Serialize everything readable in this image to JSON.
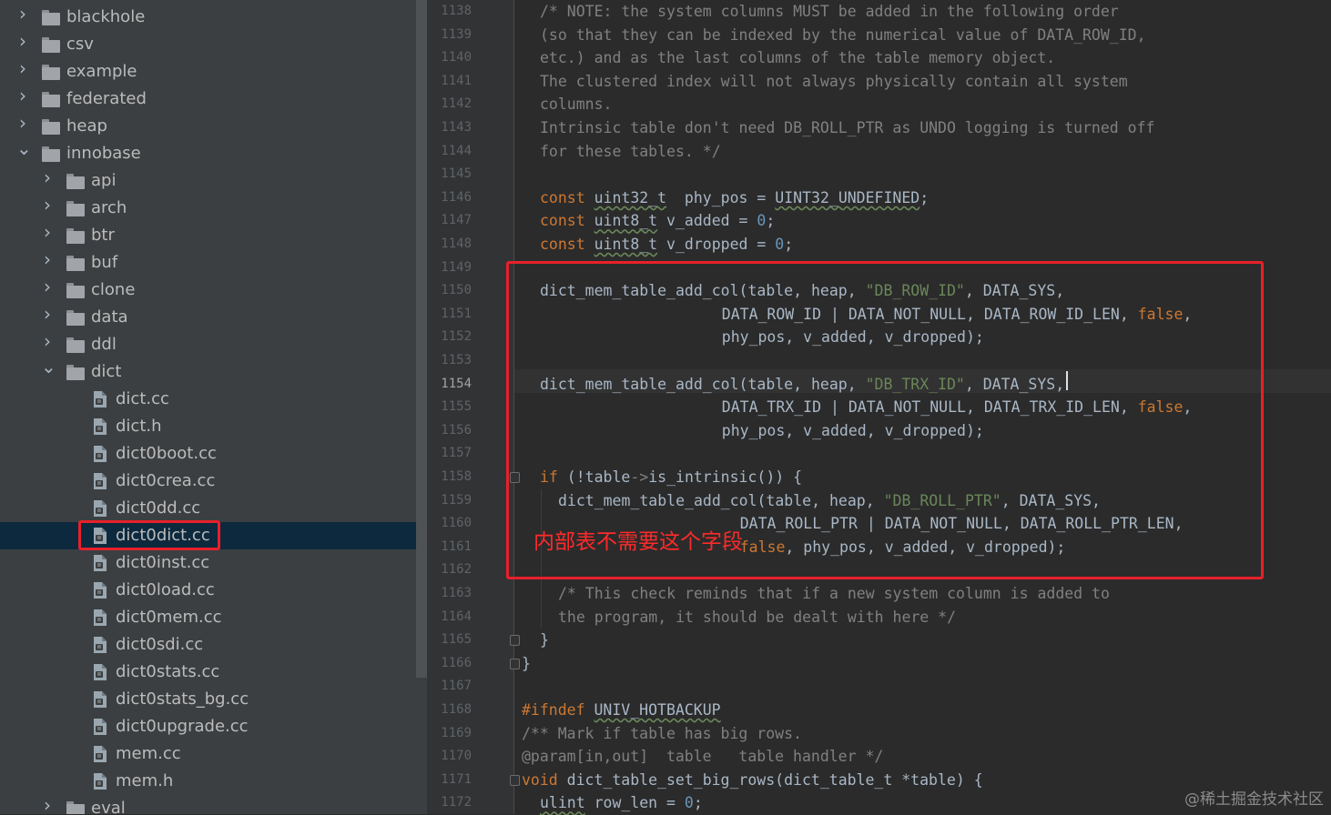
{
  "project_tree": {
    "items": [
      {
        "label": "blackhole",
        "type": "folder",
        "depth": 0,
        "expanded": false
      },
      {
        "label": "csv",
        "type": "folder",
        "depth": 0,
        "expanded": false
      },
      {
        "label": "example",
        "type": "folder",
        "depth": 0,
        "expanded": false
      },
      {
        "label": "federated",
        "type": "folder",
        "depth": 0,
        "expanded": false
      },
      {
        "label": "heap",
        "type": "folder",
        "depth": 0,
        "expanded": false
      },
      {
        "label": "innobase",
        "type": "folder",
        "depth": 0,
        "expanded": true
      },
      {
        "label": "api",
        "type": "folder",
        "depth": 1,
        "expanded": false
      },
      {
        "label": "arch",
        "type": "folder",
        "depth": 1,
        "expanded": false
      },
      {
        "label": "btr",
        "type": "folder",
        "depth": 1,
        "expanded": false
      },
      {
        "label": "buf",
        "type": "folder",
        "depth": 1,
        "expanded": false
      },
      {
        "label": "clone",
        "type": "folder",
        "depth": 1,
        "expanded": false
      },
      {
        "label": "data",
        "type": "folder",
        "depth": 1,
        "expanded": false
      },
      {
        "label": "ddl",
        "type": "folder",
        "depth": 1,
        "expanded": false
      },
      {
        "label": "dict",
        "type": "folder",
        "depth": 1,
        "expanded": true
      },
      {
        "label": "dict.cc",
        "type": "file",
        "depth": 2
      },
      {
        "label": "dict.h",
        "type": "file",
        "depth": 2
      },
      {
        "label": "dict0boot.cc",
        "type": "file",
        "depth": 2
      },
      {
        "label": "dict0crea.cc",
        "type": "file",
        "depth": 2
      },
      {
        "label": "dict0dd.cc",
        "type": "file",
        "depth": 2
      },
      {
        "label": "dict0dict.cc",
        "type": "file",
        "depth": 2,
        "selected": true
      },
      {
        "label": "dict0inst.cc",
        "type": "file",
        "depth": 2
      },
      {
        "label": "dict0load.cc",
        "type": "file",
        "depth": 2
      },
      {
        "label": "dict0mem.cc",
        "type": "file",
        "depth": 2
      },
      {
        "label": "dict0sdi.cc",
        "type": "file",
        "depth": 2
      },
      {
        "label": "dict0stats.cc",
        "type": "file",
        "depth": 2
      },
      {
        "label": "dict0stats_bg.cc",
        "type": "file",
        "depth": 2
      },
      {
        "label": "dict0upgrade.cc",
        "type": "file",
        "depth": 2
      },
      {
        "label": "mem.cc",
        "type": "file",
        "depth": 2
      },
      {
        "label": "mem.h",
        "type": "file",
        "depth": 2
      },
      {
        "label": "eval",
        "type": "folder",
        "depth": 1,
        "expanded": false
      }
    ]
  },
  "editor": {
    "current_line": "1154",
    "lines": [
      {
        "n": "1138",
        "indent": 1,
        "tokens": [
          [
            "cm",
            "/* NOTE: the system columns MUST be added in the following order"
          ]
        ]
      },
      {
        "n": "1139",
        "indent": 1,
        "tokens": [
          [
            "cm",
            "(so that they can be indexed by the numerical value of DATA_ROW_ID,"
          ]
        ]
      },
      {
        "n": "1140",
        "indent": 1,
        "tokens": [
          [
            "cm",
            "etc.) and as the last columns of the table memory object."
          ]
        ]
      },
      {
        "n": "1141",
        "indent": 1,
        "tokens": [
          [
            "cm",
            "The clustered index will not always physically contain all system"
          ]
        ]
      },
      {
        "n": "1142",
        "indent": 1,
        "tokens": [
          [
            "cm",
            "columns."
          ]
        ]
      },
      {
        "n": "1143",
        "indent": 1,
        "tokens": [
          [
            "cm",
            "Intrinsic table don't need DB_ROLL_PTR as UNDO logging is turned off"
          ]
        ]
      },
      {
        "n": "1144",
        "indent": 1,
        "tokens": [
          [
            "cm",
            "for these tables. */"
          ]
        ]
      },
      {
        "n": "1145",
        "indent": 1,
        "tokens": []
      },
      {
        "n": "1146",
        "indent": 1,
        "tokens": [
          [
            "kw",
            "const "
          ],
          [
            "ul",
            "uint32_t"
          ],
          [
            "",
            "  phy_pos = "
          ],
          [
            "ul",
            "UINT32_UNDEFINED"
          ],
          [
            "",
            ";"
          ]
        ]
      },
      {
        "n": "1147",
        "indent": 1,
        "tokens": [
          [
            "kw",
            "const "
          ],
          [
            "ul",
            "uint8_t"
          ],
          [
            "",
            " v_added = "
          ],
          [
            "num",
            "0"
          ],
          [
            "",
            ";"
          ]
        ]
      },
      {
        "n": "1148",
        "indent": 1,
        "tokens": [
          [
            "kw",
            "const "
          ],
          [
            "ul",
            "uint8_t"
          ],
          [
            "",
            " v_dropped = "
          ],
          [
            "num",
            "0"
          ],
          [
            "",
            ";"
          ]
        ]
      },
      {
        "n": "1149",
        "indent": 1,
        "tokens": []
      },
      {
        "n": "1150",
        "indent": 1,
        "tokens": [
          [
            "",
            "dict_mem_table_add_col(table, heap, "
          ],
          [
            "str",
            "\"DB_ROW_ID\""
          ],
          [
            "",
            ", DATA_SYS,"
          ]
        ]
      },
      {
        "n": "1151",
        "indent": 11,
        "tokens": [
          [
            "",
            "DATA_ROW_ID | DATA_NOT_NULL, DATA_ROW_ID_LEN, "
          ],
          [
            "kw",
            "false"
          ],
          [
            "",
            ","
          ]
        ]
      },
      {
        "n": "1152",
        "indent": 11,
        "tokens": [
          [
            "",
            "phy_pos, v_added, v_dropped);"
          ]
        ]
      },
      {
        "n": "1153",
        "indent": 1,
        "tokens": []
      },
      {
        "n": "1154",
        "indent": 1,
        "tokens": [
          [
            "",
            "dict_mem_table_add_col(table, heap, "
          ],
          [
            "str",
            "\"DB_TRX_ID\""
          ],
          [
            "",
            ", DATA_SYS,"
          ]
        ]
      },
      {
        "n": "1155",
        "indent": 11,
        "tokens": [
          [
            "",
            "DATA_TRX_ID | DATA_NOT_NULL, DATA_TRX_ID_LEN, "
          ],
          [
            "kw",
            "false"
          ],
          [
            "",
            ","
          ]
        ]
      },
      {
        "n": "1156",
        "indent": 11,
        "tokens": [
          [
            "",
            "phy_pos, v_added, v_dropped);"
          ]
        ]
      },
      {
        "n": "1157",
        "indent": 1,
        "tokens": []
      },
      {
        "n": "1158",
        "indent": 1,
        "tokens": [
          [
            "kw",
            "if"
          ],
          [
            "",
            " (!table"
          ],
          [
            "cm",
            "->"
          ],
          [
            "",
            "is_intrinsic()) {"
          ]
        ]
      },
      {
        "n": "1159",
        "indent": 2,
        "tokens": [
          [
            "",
            "dict_mem_table_add_col(table, heap, "
          ],
          [
            "str",
            "\"DB_ROLL_PTR\""
          ],
          [
            "",
            ", DATA_SYS,"
          ]
        ]
      },
      {
        "n": "1160",
        "indent": 12,
        "tokens": [
          [
            "",
            "DATA_ROLL_PTR | DATA_NOT_NULL, DATA_ROLL_PTR_LEN,"
          ]
        ]
      },
      {
        "n": "1161",
        "indent": 12,
        "tokens": [
          [
            "kw",
            "false"
          ],
          [
            "",
            ", phy_pos, v_added, v_dropped);"
          ]
        ]
      },
      {
        "n": "1162",
        "indent": 1,
        "tokens": []
      },
      {
        "n": "1163",
        "indent": 2,
        "tokens": [
          [
            "cm",
            "/* This check reminds that if a new system column is added to"
          ]
        ]
      },
      {
        "n": "1164",
        "indent": 2,
        "tokens": [
          [
            "cm",
            "the program, it should be dealt with here */"
          ]
        ]
      },
      {
        "n": "1165",
        "indent": 1,
        "tokens": [
          [
            "",
            "}"
          ]
        ]
      },
      {
        "n": "1166",
        "indent": 0,
        "tokens": [
          [
            "",
            "}"
          ]
        ]
      },
      {
        "n": "1167",
        "indent": 0,
        "tokens": []
      },
      {
        "n": "1168",
        "indent": 0,
        "tokens": [
          [
            "kw",
            "#ifndef "
          ],
          [
            "ul",
            "UNIV_HOTBACKUP"
          ]
        ]
      },
      {
        "n": "1169",
        "indent": 0,
        "tokens": [
          [
            "cm",
            "/** Mark if table has big rows."
          ]
        ]
      },
      {
        "n": "1170",
        "indent": 0,
        "tokens": [
          [
            "cm",
            "@param[in,out]  table   table handler */"
          ]
        ]
      },
      {
        "n": "1171",
        "indent": 0,
        "tokens": [
          [
            "kw",
            "void"
          ],
          [
            "",
            " dict_table_set_big_rows(dict_table_t *table) {"
          ]
        ]
      },
      {
        "n": "1172",
        "indent": 1,
        "tokens": [
          [
            "ul",
            "ulint"
          ],
          [
            "",
            " row_len = "
          ],
          [
            "num",
            "0"
          ],
          [
            "",
            ";"
          ]
        ]
      }
    ]
  },
  "annotation": "内部表不需要这个字段",
  "watermark": "@稀土掘金技术社区",
  "colors": {
    "highlight_box": "#e8202a",
    "annotation_text": "#ff2a2a",
    "selection": "#0d293e"
  }
}
